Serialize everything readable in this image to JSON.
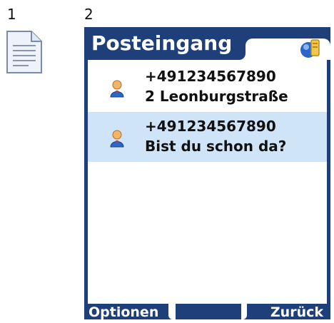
{
  "labels": {
    "one": "1",
    "two": "2"
  },
  "phone": {
    "title": "Posteingang",
    "softkeys": {
      "left": "Optionen",
      "right": "Zurück"
    },
    "messages": [
      {
        "from": "+491234567890",
        "text": "2 Leonburgstraße",
        "selected": false
      },
      {
        "from": "+491234567890",
        "text": "Bist du schon da?",
        "selected": true
      }
    ]
  },
  "colors": {
    "frame": "#1f3f7a",
    "selected_row": "#cfe5f7"
  },
  "icons": {
    "document": "document-icon",
    "help": "help-icon",
    "contact": "contact-icon"
  }
}
